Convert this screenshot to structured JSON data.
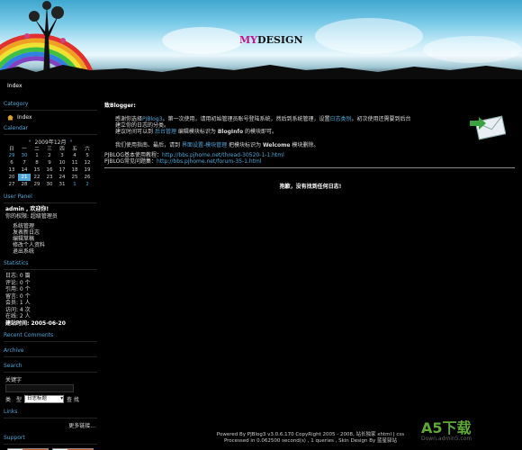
{
  "header": {
    "logo_my": "MY",
    "logo_design": "DESIGN"
  },
  "nav": {
    "index": "Index"
  },
  "sidebar": {
    "category": {
      "title": "Category",
      "items": [
        "Index"
      ]
    },
    "calendar": {
      "title": "Calendar",
      "month": "2009年12月",
      "prev": "«",
      "next": "»",
      "weekdays": [
        "日",
        "一",
        "二",
        "三",
        "四",
        "五",
        "六"
      ],
      "rows": [
        [
          "29",
          "30",
          "1",
          "2",
          "3",
          "4",
          "5"
        ],
        [
          "6",
          "7",
          "8",
          "9",
          "10",
          "11",
          "12"
        ],
        [
          "13",
          "14",
          "15",
          "16",
          "17",
          "18",
          "19"
        ],
        [
          "20",
          "21",
          "22",
          "23",
          "24",
          "25",
          "26"
        ],
        [
          "27",
          "28",
          "29",
          "30",
          "31",
          "1",
          "2"
        ]
      ]
    },
    "user_panel": {
      "title": "User Panel",
      "welcome": "admin , 欢迎你!",
      "role": "你的权限: 超级管理员",
      "links": [
        "系统管理",
        "发表新日志",
        "编辑草稿",
        "修改个人资料",
        "退出系统"
      ]
    },
    "statistics": {
      "title": "Statistics",
      "lines": [
        "日志: 0 篇",
        "评论: 0 个",
        "引用: 0 个",
        "留言: 0 个",
        "会员: 1 人",
        "访问: 4 次",
        "在线: 2 人",
        "建站时间: 2005-06-20"
      ]
    },
    "recent_comments": {
      "title": "Recent Comments"
    },
    "archive": {
      "title": "Archive"
    },
    "search": {
      "title": "Search",
      "keyword_label": "关键字",
      "type_label": "类　型",
      "type_value": "日志标题",
      "button": "查 找"
    },
    "links": {
      "title": "Links",
      "more": "更多链接..."
    },
    "support": {
      "title": "Support"
    }
  },
  "main": {
    "notice_title": "致Blogger:",
    "body_1a": "感谢你选择",
    "body_1b": "PJBlog3",
    "body_1c": "。第一次使用，请用初始管理员账号登陆系统，然后到系统管理，设置",
    "body_1d": "日志类别",
    "body_1e": "。初次使用还需要到后台建立你的日志的分类。",
    "body_2a": "建议时间可以到",
    "body_2b": "后台管理",
    "body_2c": "编辑模块标识为",
    "body_2d": "BlogInfo",
    "body_2e": "的模块即可。",
    "body_3a": "我们使用指南、最后，请到",
    "body_3b": "界面设置-模块管理",
    "body_3c": "把模块标识为",
    "body_3d": "Welcome",
    "body_3e": "模块删除。",
    "faq_1_label": "PJBLOG基本使用教程：",
    "faq_1_url": "http://bbs.pjhome.net/thread-30520-1-1.html",
    "faq_2_label": "PJBLOG常见问题集：",
    "faq_2_url": "http://bbs.pjhome.net/forum-35-1.html",
    "empty_msg": "抱歉，没有找到任何日志!"
  },
  "footer": {
    "line1": "Powered By PJBlog3 v3.0.6.170 CopyRight 2005 - 2008, 站长独家 xhtml | css",
    "line2": "Processed in 0.062500 second(s) , 1 queries , Skin Design By 蓝星驿站"
  },
  "watermark": {
    "main": "A5下载",
    "sub": "Down.admin5.com"
  },
  "colors": {
    "accent": "#4ea7d7",
    "background": "#000000"
  }
}
